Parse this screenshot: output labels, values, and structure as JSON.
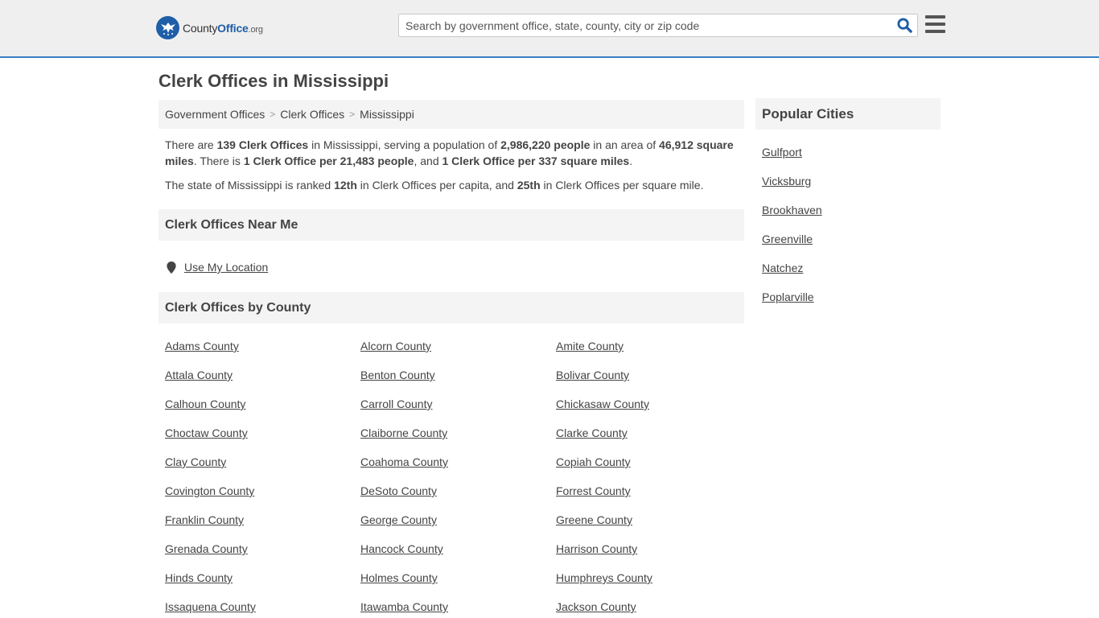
{
  "header": {
    "logo": {
      "county": "County",
      "office": "Office",
      "org": ".org"
    },
    "search_placeholder": "Search by government office, state, county, city or zip code",
    "search_icon": "search-icon",
    "menu_icon": "hamburger-menu-icon",
    "accent": "#3b7dc4"
  },
  "page": {
    "title": "Clerk Offices in Mississippi"
  },
  "breadcrumb": {
    "items": [
      "Government Offices",
      "Clerk Offices",
      "Mississippi"
    ],
    "separator": ">"
  },
  "intro": {
    "p1": {
      "t1": "There are ",
      "b1": "139 Clerk Offices",
      "t2": " in Mississippi, serving a population of ",
      "b2": "2,986,220 people",
      "t3": " in an area of ",
      "b3": "46,912 square miles",
      "t4": ". There is ",
      "b4": "1 Clerk Office per 21,483 people",
      "t5": ", and ",
      "b5": "1 Clerk Office per 337 square miles",
      "t6": "."
    },
    "p2": {
      "t1": "The state of Mississippi is ranked ",
      "b1": "12th",
      "t2": " in Clerk Offices per capita, and ",
      "b2": "25th",
      "t3": " in Clerk Offices per square mile."
    }
  },
  "near_me": {
    "heading": "Clerk Offices Near Me",
    "link": "Use My Location",
    "icon": "map-pin-icon"
  },
  "by_county": {
    "heading": "Clerk Offices by County",
    "counties": [
      "Adams County",
      "Alcorn County",
      "Amite County",
      "Attala County",
      "Benton County",
      "Bolivar County",
      "Calhoun County",
      "Carroll County",
      "Chickasaw County",
      "Choctaw County",
      "Claiborne County",
      "Clarke County",
      "Clay County",
      "Coahoma County",
      "Copiah County",
      "Covington County",
      "DeSoto County",
      "Forrest County",
      "Franklin County",
      "George County",
      "Greene County",
      "Grenada County",
      "Hancock County",
      "Harrison County",
      "Hinds County",
      "Holmes County",
      "Humphreys County",
      "Issaquena County",
      "Itawamba County",
      "Jackson County"
    ]
  },
  "sidebar": {
    "heading": "Popular Cities",
    "cities": [
      "Gulfport",
      "Vicksburg",
      "Brookhaven",
      "Greenville",
      "Natchez",
      "Poplarville"
    ]
  }
}
